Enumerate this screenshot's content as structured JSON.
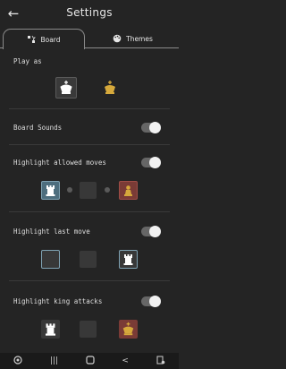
{
  "header": {
    "title": "Settings",
    "back_icon": "back-arrow-icon"
  },
  "tabs": [
    {
      "label": "Board",
      "icon": "board-icon",
      "active": true
    },
    {
      "label": "Themes",
      "icon": "palette-icon",
      "active": false
    }
  ],
  "play_as": {
    "label": "Play as",
    "options": [
      "white-king",
      "black-king"
    ],
    "selected": "white-king"
  },
  "board_sounds": {
    "label": "Board Sounds",
    "enabled": true
  },
  "highlight_allowed_moves": {
    "label": "Highlight allowed moves",
    "enabled": true
  },
  "highlight_last_move": {
    "label": "Highlight last move",
    "enabled": true
  },
  "highlight_king_attacks": {
    "label": "Highlight king attacks",
    "enabled": true
  },
  "colors": {
    "background": "#242424",
    "accent_gold": "#d6a93c",
    "square_blue": "#4e6e7e",
    "square_red": "#7a3b36",
    "square_dark": "#383838"
  },
  "navbar": {
    "items": [
      "app-logo-icon",
      "recents-icon",
      "home-icon",
      "back-icon",
      "accessibility-icon"
    ]
  }
}
